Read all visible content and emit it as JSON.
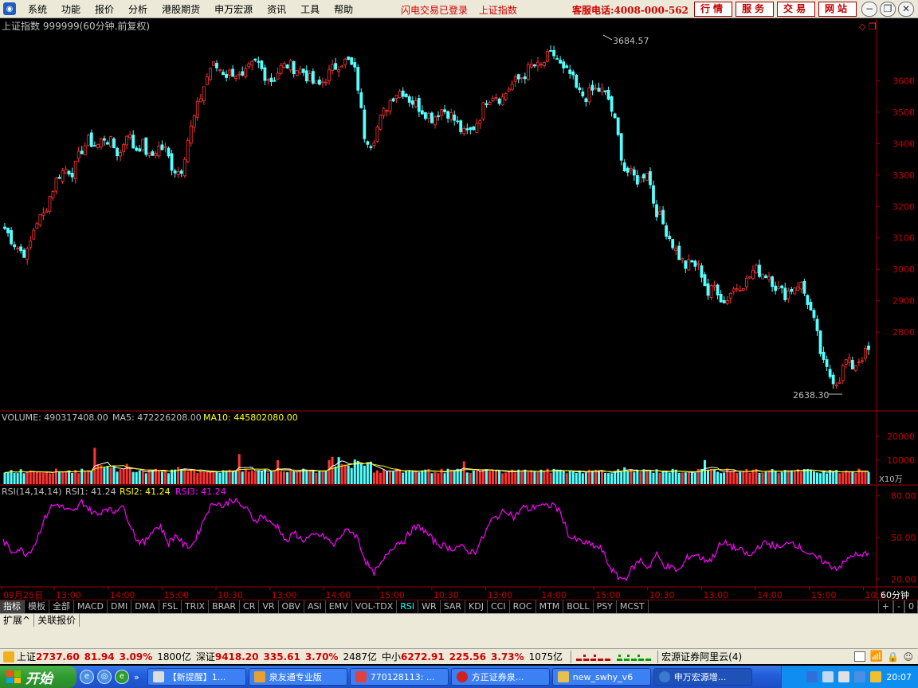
{
  "menu": {
    "items": [
      "系统",
      "功能",
      "报价",
      "分析",
      "港股期货",
      "申万宏源",
      "资讯",
      "工具",
      "帮助"
    ],
    "status_links": [
      "闪电交易已登录",
      "上证指数"
    ],
    "hotline": "客服电话:4008-000-562",
    "buttons": [
      "行情",
      "服务",
      "交易",
      "网站"
    ]
  },
  "chart": {
    "title": "上证指数 999999(60分钟.前复权)",
    "high_label": "3684.57",
    "low_label": "2638.30",
    "volume_header": {
      "volume": "VOLUME: 490317408.00",
      "ma5": "MA5: 472226208.00",
      "ma10": "MA10: 445802080.00"
    },
    "volume_unit": "X10万",
    "rsi_header": {
      "name": "RSI(14,14,14)",
      "rsi1": "RSI1: 41.24",
      "rsi2": "RSI2: 41.24",
      "rsi3": "RSI3: 41.24"
    },
    "time_axis": [
      "09月25日",
      "13:00",
      "14:00",
      "15:00",
      "10:30",
      "13:00",
      "14:00",
      "15:00",
      "10:30",
      "13:00",
      "14:00",
      "15:00",
      "10:30",
      "13:00",
      "14:00",
      "15:00",
      "10:3"
    ],
    "period_label": "60分钟"
  },
  "chart_data": [
    {
      "type": "candlestick",
      "title": "上证指数 999999(60分钟.前复权)",
      "ylabel": "",
      "ylim": [
        2600,
        3700
      ],
      "y_ticks": [
        2800,
        2900,
        3000,
        3100,
        3200,
        3300,
        3400,
        3500,
        3600
      ],
      "annotations": [
        {
          "label": "3684.57",
          "value": 3684.57
        },
        {
          "label": "2638.30",
          "value": 2638.3
        }
      ],
      "close_path": [
        3130,
        3090,
        3060,
        3050,
        3150,
        3170,
        3240,
        3300,
        3320,
        3310,
        3380,
        3410,
        3390,
        3420,
        3400,
        3360,
        3440,
        3380,
        3400,
        3350,
        3390,
        3380,
        3320,
        3310,
        3420,
        3500,
        3580,
        3650,
        3640,
        3620,
        3630,
        3600,
        3640,
        3660,
        3620,
        3600,
        3640,
        3650,
        3640,
        3630,
        3600,
        3580,
        3610,
        3640,
        3660,
        3660,
        3620,
        3430,
        3400,
        3470,
        3520,
        3560,
        3570,
        3540,
        3520,
        3500,
        3480,
        3510,
        3500,
        3470,
        3430,
        3440,
        3480,
        3540,
        3560,
        3540,
        3580,
        3600,
        3620,
        3650,
        3640,
        3675,
        3684,
        3630,
        3620,
        3560,
        3550,
        3570,
        3570,
        3540,
        3450,
        3320,
        3300,
        3280,
        3320,
        3200,
        3150,
        3100,
        3050,
        3010,
        3020,
        3000,
        2920,
        2950,
        2890,
        2930,
        2950,
        2960,
        3000,
        2990,
        2980,
        2940,
        2920,
        2940,
        2960,
        2900,
        2820,
        2700,
        2660,
        2640,
        2710,
        2690,
        2720,
        2740
      ]
    },
    {
      "type": "bar",
      "title": "VOLUME",
      "series": [
        {
          "name": "VOLUME",
          "values": []
        },
        {
          "name": "MA5",
          "values": []
        },
        {
          "name": "MA10",
          "values": []
        }
      ],
      "y_ticks": [
        10000,
        20000
      ],
      "ylim": [
        0,
        28000
      ],
      "base_level": 4500,
      "peak_level": 11000
    },
    {
      "type": "line",
      "title": "RSI(14,14,14)",
      "series": [
        {
          "name": "RSI1",
          "values": [
            48,
            40,
            42,
            38,
            45,
            60,
            72,
            74,
            70,
            68,
            76,
            70,
            66,
            72,
            68,
            74,
            62,
            48,
            46,
            56,
            58,
            46,
            52,
            44,
            44,
            56,
            70,
            76,
            72,
            78,
            74,
            70,
            62,
            66,
            60,
            58,
            46,
            54,
            48,
            50,
            52,
            50,
            44,
            52,
            56,
            50,
            34,
            24,
            30,
            40,
            46,
            48,
            56,
            58,
            52,
            46,
            44,
            42,
            44,
            40,
            40,
            50,
            62,
            66,
            70,
            64,
            72,
            70,
            74,
            72,
            74,
            66,
            50,
            48,
            46,
            44,
            42,
            30,
            22,
            20,
            28,
            34,
            28,
            38,
            30,
            28,
            26,
            36,
            38,
            34,
            34,
            44,
            46,
            42,
            40,
            36,
            44,
            46,
            44,
            42,
            48,
            44,
            40,
            36,
            34,
            30,
            28,
            32,
            38,
            36,
            40
          ]
        }
      ],
      "ylim": [
        15,
        85
      ],
      "y_ticks": [
        20,
        50,
        80
      ]
    }
  ],
  "tabs": {
    "items": [
      "指标",
      "模板",
      "全部",
      "MACD",
      "DMI",
      "DMA",
      "FSL",
      "TRIX",
      "BRAR",
      "CR",
      "VR",
      "OBV",
      "ASI",
      "EMV",
      "VOL-TDX",
      "RSI",
      "WR",
      "SAR",
      "KDJ",
      "CCI",
      "ROC",
      "MTM",
      "BOLL",
      "PSY",
      "MCST"
    ],
    "active": "RSI",
    "right": [
      "+",
      "-",
      "0"
    ]
  },
  "subtabs": [
    "扩展^",
    "关联报价"
  ],
  "ticker": {
    "sh_label": "上证",
    "sh_price": "2737.60",
    "sh_change": "81.94",
    "sh_pct": "3.09%",
    "sh_amt": "1800亿",
    "sz_label": "深证",
    "sz_price": "9418.20",
    "sz_change": "335.61",
    "sz_pct": "3.70%",
    "sz_amt": "2487亿",
    "zx_label": "中小",
    "zx_price": "6272.91",
    "zx_change": "225.56",
    "zx_pct": "3.73%",
    "zx_amt": "1075亿",
    "server": "宏源证券阿里云(4)"
  },
  "taskbar": {
    "start": "开始",
    "tasks": [
      "【新提醒】1...",
      "泉友通专业版",
      "770128113: ...",
      "方正证券泉...",
      "new_swhy_v6",
      "申万宏源增..."
    ],
    "clock": "20:07"
  },
  "colors": {
    "up": "#ff3232",
    "down": "#54ffff",
    "axis": "#a00000",
    "ma5": "#ffffff",
    "ma10": "#ffff00",
    "rsi": "#ff00ff"
  }
}
